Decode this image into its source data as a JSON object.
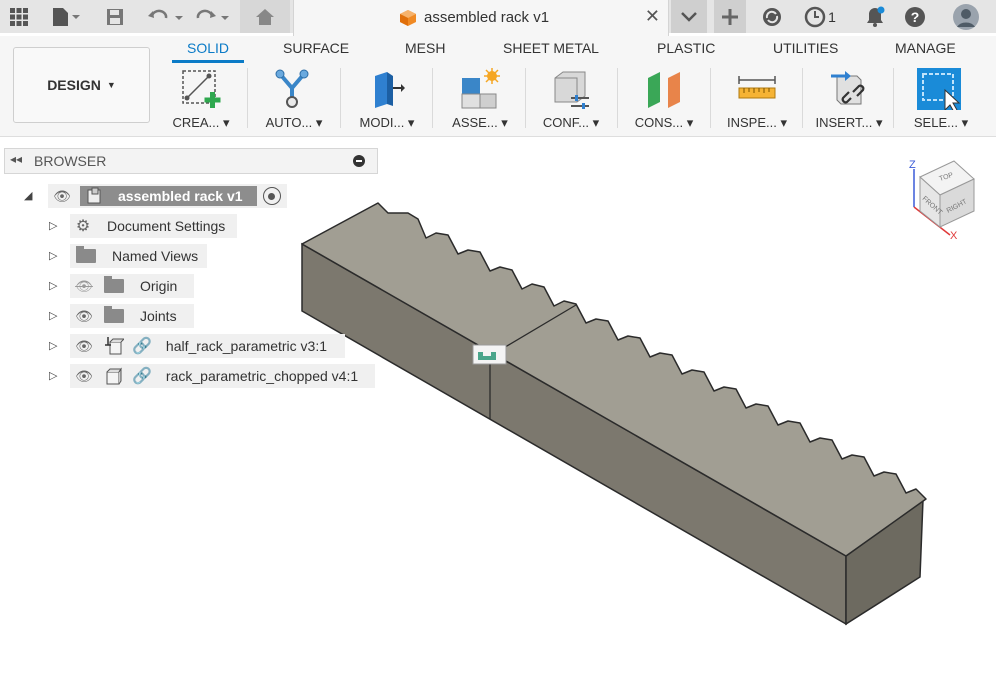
{
  "topbar": {
    "document_title": "assembled rack v1",
    "job_count": "1",
    "icons": [
      "grid-icon",
      "file-icon",
      "save-icon",
      "undo-icon",
      "redo-icon",
      "home-icon",
      "close-icon",
      "chevron-down-icon",
      "plus-icon",
      "sync-icon",
      "clock-icon",
      "bell-icon",
      "help-icon",
      "user-icon"
    ]
  },
  "toolbar": {
    "workspace": "DESIGN",
    "tabs": [
      "SOLID",
      "SURFACE",
      "MESH",
      "SHEET METAL",
      "PLASTIC",
      "UTILITIES",
      "MANAGE"
    ],
    "active_tab": "SOLID",
    "groups": [
      "CREA...",
      "AUTO...",
      "MODI...",
      "ASSE...",
      "CONF...",
      "CONS...",
      "INSPE...",
      "INSERT...",
      "SELE..."
    ]
  },
  "browser": {
    "title": "BROWSER",
    "root": "assembled rack v1",
    "items": [
      {
        "label": "Document Settings"
      },
      {
        "label": "Named Views"
      },
      {
        "label": "Origin"
      },
      {
        "label": "Joints"
      },
      {
        "label": "half_rack_parametric v3:1"
      },
      {
        "label": "rack_parametric_chopped v4:1"
      }
    ]
  },
  "viewcube": {
    "faces": [
      "TOP",
      "FRONT",
      "RIGHT"
    ],
    "axes": [
      "Z",
      "X"
    ]
  },
  "colors": {
    "accent": "#0b7bc7",
    "model_top": "#a19e93",
    "model_front": "#7c786e",
    "model_side": "#6d6a60"
  }
}
